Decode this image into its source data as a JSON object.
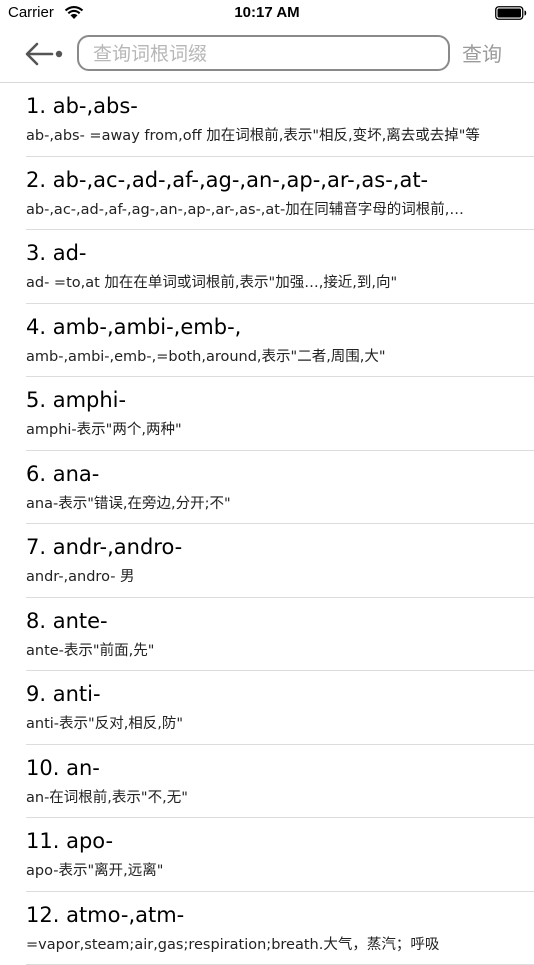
{
  "status_bar": {
    "carrier": "Carrier",
    "time": "10:17 AM"
  },
  "nav": {
    "search_placeholder": "查询词根词缀",
    "search_button": "查询"
  },
  "items": [
    {
      "title": "1. ab-,abs-",
      "desc": "ab-,abs- =away from,off 加在词根前,表示\"相反,变坏,离去或去掉\"等"
    },
    {
      "title": "2. ab-,ac-,ad-,af-,ag-,an-,ap-,ar-,as-,at-",
      "desc": "ab-,ac-,ad-,af-,ag-,an-,ap-,ar-,as-,at-加在同辅音字母的词根前,…"
    },
    {
      "title": "3. ad-",
      "desc": "ad- =to,at 加在在单词或词根前,表示\"加强…,接近,到,向\""
    },
    {
      "title": "4. amb-,ambi-,emb-,",
      "desc": "amb-,ambi-,emb-,=both,around,表示\"二者,周围,大\""
    },
    {
      "title": "5. amphi-",
      "desc": "amphi-表示\"两个,两种\""
    },
    {
      "title": "6. ana-",
      "desc": "ana-表示\"错误,在旁边,分开;不\""
    },
    {
      "title": "7. andr-,andro-",
      "desc": "andr-,andro- 男"
    },
    {
      "title": "8. ante-",
      "desc": "ante-表示\"前面,先\""
    },
    {
      "title": "9. anti-",
      "desc": "anti-表示\"反对,相反,防\""
    },
    {
      "title": "10. an-",
      "desc": "an-在词根前,表示\"不,无\""
    },
    {
      "title": "11. apo-",
      "desc": "apo-表示\"离开,远离\""
    },
    {
      "title": "12. atmo-,atm-",
      "desc": "=vapor,steam;air,gas;respiration;breath.大气，蒸汽；呼吸"
    }
  ]
}
